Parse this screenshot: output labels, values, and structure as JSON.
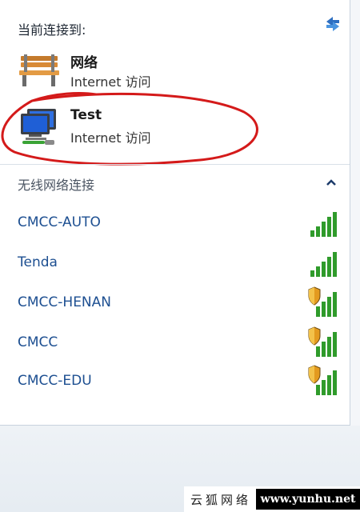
{
  "header": {
    "title": "当前连接到:"
  },
  "connections": [
    {
      "name": "网络",
      "access": "Internet 访问",
      "icon": "park-bench-icon"
    },
    {
      "name": "Test",
      "access": "Internet 访问",
      "icon": "wired-network-icon"
    }
  ],
  "wireless": {
    "title": "无线网络连接",
    "networks": [
      {
        "name": "CMCC-AUTO",
        "secured": false
      },
      {
        "name": "Tenda",
        "secured": false
      },
      {
        "name": "CMCC-HENAN",
        "secured": true
      },
      {
        "name": "CMCC",
        "secured": true
      },
      {
        "name": "CMCC-EDU",
        "secured": true
      }
    ]
  },
  "watermark": {
    "left": "云狐网络",
    "right": "www.yunhu.net"
  },
  "colors": {
    "network_name": "#1d4f91",
    "signal_green": "#2f9b2b",
    "annotation_red": "#d41a1a",
    "shield_orange": "#e39a1f"
  }
}
